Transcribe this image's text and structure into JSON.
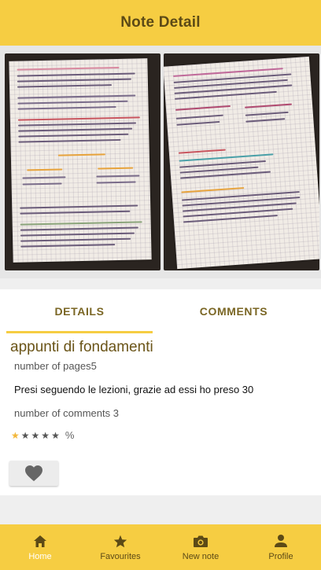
{
  "header": {
    "title": "Note Detail"
  },
  "tabs": [
    {
      "label": "DETAILS",
      "active": true
    },
    {
      "label": "COMMENTS",
      "active": false
    }
  ],
  "note": {
    "title": "appunti di fondamenti",
    "pages_text": "number of pages5",
    "description": "Presi seguendo le lezioni, grazie ad essi ho preso 30",
    "comments_text": "number of comments 3",
    "rating": {
      "filled": 1,
      "total": 5,
      "suffix": "%"
    }
  },
  "bottom_nav": [
    {
      "label": "Home",
      "icon": "home-icon",
      "active": true
    },
    {
      "label": "Favourites",
      "icon": "star-icon",
      "active": false
    },
    {
      "label": "New note",
      "icon": "camera-icon",
      "active": false
    },
    {
      "label": "Profile",
      "icon": "person-icon",
      "active": false
    }
  ],
  "colors": {
    "accent": "#f6cd42",
    "title_text": "#5c4a16",
    "star_on": "#f3b73a",
    "nav_active": "#ffffff"
  }
}
